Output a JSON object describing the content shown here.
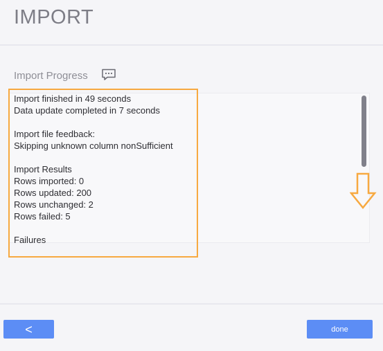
{
  "header": {
    "title": "IMPORT"
  },
  "progress": {
    "section_title": "Import Progress",
    "feedback_icon": "comment-icon",
    "log_lines": [
      "Import finished in 49 seconds",
      "Data update completed in 7 seconds",
      "",
      "Import file feedback:",
      "Skipping unknown column nonSufficient",
      "",
      "Import Results",
      "Rows imported: 0",
      "Rows updated: 200",
      "Rows unchanged: 2",
      "Rows failed: 5",
      "",
      "Failures"
    ]
  },
  "annotation": {
    "highlight_color": "#f7a940",
    "arrow_icon": "down-arrow-icon"
  },
  "footer": {
    "back_label": "<",
    "done_label": "done",
    "button_color": "#5c8df5"
  }
}
